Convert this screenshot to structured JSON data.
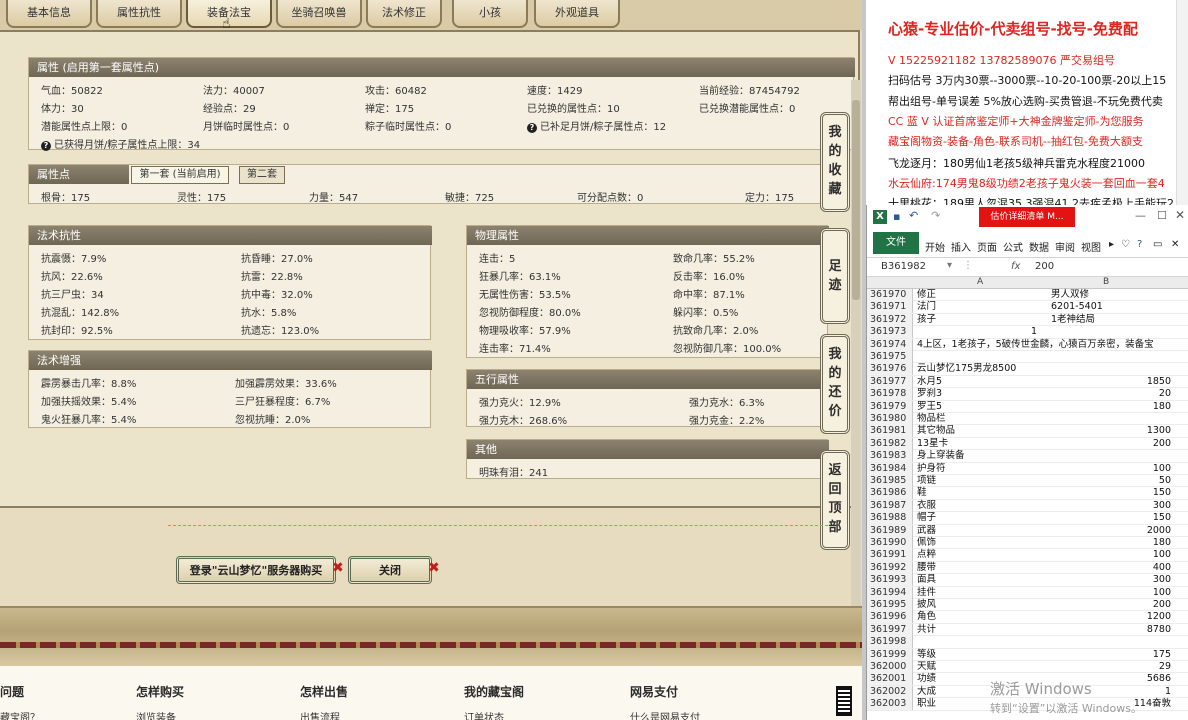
{
  "tabs": [
    "基本信息",
    "属性抗性",
    "装备法宝",
    "坐骑召唤兽",
    "法术修正",
    "小孩",
    "外观道具"
  ],
  "attr_section": {
    "title": "属性 (启用第一套属性点)",
    "rows": [
      [
        "气血：50822",
        "法力：40007",
        "攻击：60482",
        "速度：1429",
        "当前经验：87454792"
      ],
      [
        "体力：30",
        "经验点：29",
        "禅定：175",
        "已兑换的属性点：10",
        "已兑换潜能属性点：0"
      ],
      [
        "潜能属性点上限：0",
        "月饼临时属性点：0",
        "粽子临时属性点：0",
        "已补足月饼/粽子属性点：12",
        ""
      ]
    ],
    "note": "已获得月饼/粽子属性点上限：34"
  },
  "points_section": {
    "title": "属性点",
    "tab1": "第一套 (当前启用)",
    "tab2": "第二套",
    "values": [
      "根骨：175",
      "灵性：175",
      "力量：547",
      "敏捷：725",
      "可分配点数：0",
      "定力：175"
    ]
  },
  "resist_section": {
    "title": "法术抗性",
    "rows": [
      [
        "抗震慑：7.9%",
        "抗昏睡：27.0%"
      ],
      [
        "抗风：22.6%",
        "抗雷：22.8%"
      ],
      [
        "抗三尸虫：34",
        "抗中毒：32.0%"
      ],
      [
        "抗混乱：142.8%",
        "抗水：5.8%"
      ],
      [
        "抗封印：92.5%",
        "抗遗忘：123.0%"
      ]
    ]
  },
  "boost_section": {
    "title": "法术增强",
    "rows": [
      [
        "霹雳暴击几率：8.8%",
        "加强霹雳效果：33.6%"
      ],
      [
        "加强扶摇效果：5.4%",
        "三尸狂暴程度：6.7%"
      ],
      [
        "鬼火狂暴几率：5.4%",
        "忽视抗睡：2.0%"
      ]
    ]
  },
  "physical_section": {
    "title": "物理属性",
    "rows": [
      [
        "连击：5",
        "致命几率：55.2%"
      ],
      [
        "狂暴几率：63.1%",
        "反击率：16.0%"
      ],
      [
        "无属性伤害：53.5%",
        "命中率：87.1%"
      ],
      [
        "忽视防御程度：80.0%",
        "躲闪率：0.5%"
      ],
      [
        "物理吸收率：57.9%",
        "抗致命几率：2.0%"
      ],
      [
        "连击率：71.4%",
        "忽视防御几率：100.0%"
      ]
    ]
  },
  "element_section": {
    "title": "五行属性",
    "rows": [
      [
        "强力克火：12.9%",
        "强力克水：6.3%"
      ],
      [
        "强力克木：268.6%",
        "强力克金：2.2%"
      ]
    ]
  },
  "other_section": {
    "title": "其他",
    "rows": [
      "明珠有泪：241"
    ]
  },
  "side_nav": [
    "我的收藏",
    "足迹",
    "我的还价",
    "返回顶部"
  ],
  "buttons": {
    "buy": "登录\"云山梦忆\"服务器购买",
    "close": "关闭"
  },
  "footer": {
    "heads": [
      "问题",
      "怎样购买",
      "怎样出售",
      "我的藏宝阁",
      "网易支付"
    ],
    "links": [
      "藏宝阁？",
      "浏览装备",
      "出售流程",
      "订单状态",
      "什么是网易支付"
    ]
  },
  "notes": {
    "title": "心猿-专业估价-代卖组号-找号-免费配",
    "lines": [
      {
        "text": "V 15225921182  13782589076 严交易组号",
        "color": "red"
      },
      {
        "text": "扫码估号 3万内30票--3000票--10-20-100票-20以上15",
        "color": "black"
      },
      {
        "text": "帮出组号-单号误差 5%放心选购-买贵管退-不玩免费代卖",
        "color": "black"
      },
      {
        "text": "CC 蓝 V 认证首席鉴定师+大神金牌鉴定师-为您服务",
        "color": "red"
      },
      {
        "text": "藏宝阁物资-装备-角色-联系司机--抽红包-免费大额支",
        "color": "red"
      },
      {
        "text": "飞龙逐月：180男仙1老孩5级神兵雷克水程度21000",
        "color": "black"
      },
      {
        "text": "水云仙府:174男鬼8级功绩2老孩子鬼火装一套回血一套4",
        "color": "red"
      },
      {
        "text": "十里桃花：189男人忽混35.3强混41.2去疾孟极上手能玩2",
        "color": "black"
      }
    ]
  },
  "excel": {
    "doc_title": "估价详细清单 M...",
    "ribbon_tabs": [
      "文件",
      "开始",
      "插入",
      "页面",
      "公式",
      "数据",
      "审阅",
      "视图"
    ],
    "name_box": "B361982",
    "fx": "fx",
    "formula": "200",
    "col_a": "A",
    "col_b": "B",
    "rows": [
      [
        "361970",
        "修正",
        "男人双修",
        "txt"
      ],
      [
        "361971",
        "法门",
        "6201-5401",
        "txt"
      ],
      [
        "361972",
        "孩子",
        "1老神结局",
        "txt"
      ],
      [
        "361973",
        "",
        "1",
        "mid"
      ],
      [
        "361974",
        "4上区，1老孩子，5破传世金麟，心猿百万亲密，装备宝",
        "",
        "txt"
      ],
      [
        "361975",
        "",
        "",
        "txt"
      ],
      [
        "361976",
        "云山梦忆175男龙8500",
        "",
        "txt"
      ],
      [
        "361977",
        "水月5",
        "1850",
        "num"
      ],
      [
        "361978",
        "罗刹3",
        "20",
        "num"
      ],
      [
        "361979",
        "罗王5",
        "180",
        "num"
      ],
      [
        "361980",
        "物品栏",
        "",
        "num"
      ],
      [
        "361981",
        "其它物品",
        "1300",
        "num"
      ],
      [
        "361982",
        "13星卡",
        "200",
        "num"
      ],
      [
        "361983",
        "身上穿装备",
        "",
        "num"
      ],
      [
        "361984",
        "护身符",
        "100",
        "num"
      ],
      [
        "361985",
        "项链",
        "50",
        "num"
      ],
      [
        "361986",
        "鞋",
        "150",
        "num"
      ],
      [
        "361987",
        "衣服",
        "300",
        "num"
      ],
      [
        "361988",
        "帽子",
        "150",
        "num"
      ],
      [
        "361989",
        "武器",
        "2000",
        "num"
      ],
      [
        "361990",
        "佩饰",
        "180",
        "num"
      ],
      [
        "361991",
        "点粹",
        "100",
        "num"
      ],
      [
        "361992",
        "腰带",
        "400",
        "num"
      ],
      [
        "361993",
        "面具",
        "300",
        "num"
      ],
      [
        "361994",
        "挂件",
        "100",
        "num"
      ],
      [
        "361995",
        "披风",
        "200",
        "num"
      ],
      [
        "361996",
        "角色",
        "1200",
        "num"
      ],
      [
        "361997",
        "共计",
        "8780",
        "num"
      ],
      [
        "361998",
        "",
        "",
        "num"
      ],
      [
        "361999",
        "等级",
        "175",
        "num"
      ],
      [
        "362000",
        "天赋",
        "29",
        "num"
      ],
      [
        "362001",
        "功绩",
        "5686",
        "num"
      ],
      [
        "362002",
        "大成",
        "1",
        "num"
      ],
      [
        "362003",
        "职业",
        "114奋敦",
        "num"
      ]
    ],
    "watermark": "激活 Windows",
    "watermark_sub": "转到“设置”以激活 Windows。"
  }
}
